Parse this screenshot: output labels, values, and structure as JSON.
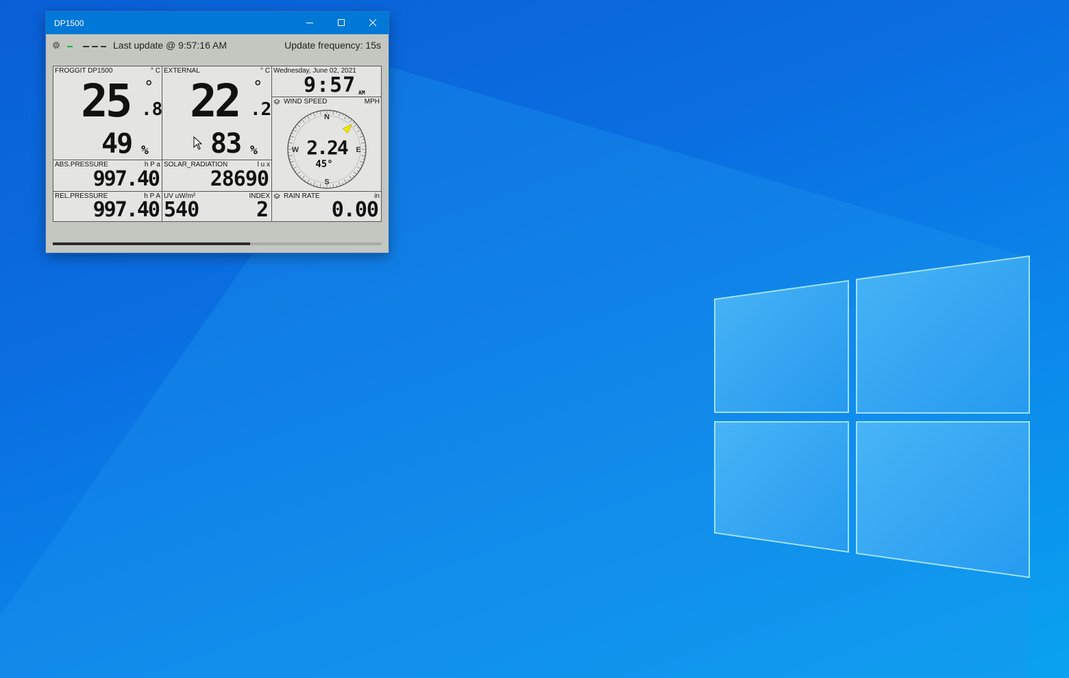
{
  "window": {
    "title": "DP1500"
  },
  "toolbar": {
    "last_update": "Last update @ 9:57:16 AM",
    "update_frequency": "Update frequency: 15s"
  },
  "indoor": {
    "label": "FROGGIT DP1500",
    "unit": "° C",
    "temp_int": "25",
    "temp_dec": ".8",
    "degree": "°",
    "humidity": "49",
    "pct": "%"
  },
  "external": {
    "label": "EXTERNAL",
    "unit": "° C",
    "temp_int": "22",
    "temp_dec": ".2",
    "degree": "°",
    "humidity": "83",
    "pct": "%"
  },
  "clock": {
    "date": "Wednesday,  June  02,  2021",
    "time": "9:57",
    "ampm": "AM"
  },
  "wind": {
    "label": "WIND SPEED",
    "unit": "MPH",
    "speed": "2.24",
    "direction_deg": "45°",
    "direction_value": 45,
    "n": "N",
    "e": "E",
    "s": "S",
    "w": "W"
  },
  "abs_pressure": {
    "label": "ABS.PRESSURE",
    "unit": "h P a",
    "value": "997.40"
  },
  "solar": {
    "label": "SOLAR_RADIATION",
    "unit": "l u x",
    "value": "28690"
  },
  "rel_pressure": {
    "label": "REL.PRESSURE",
    "unit": "h P A",
    "value": "997.40"
  },
  "uv": {
    "label": "UV  uW/m²",
    "unit": "INDEX",
    "value": "540",
    "index": "2"
  },
  "rain": {
    "label": "RAIN RATE",
    "unit": "in",
    "value": "0.00"
  },
  "progress": {
    "fraction": 0.6
  },
  "colors": {
    "titlebar": "#0078d7",
    "led": "#19b33a",
    "wind_arrow": "#f2e600"
  }
}
